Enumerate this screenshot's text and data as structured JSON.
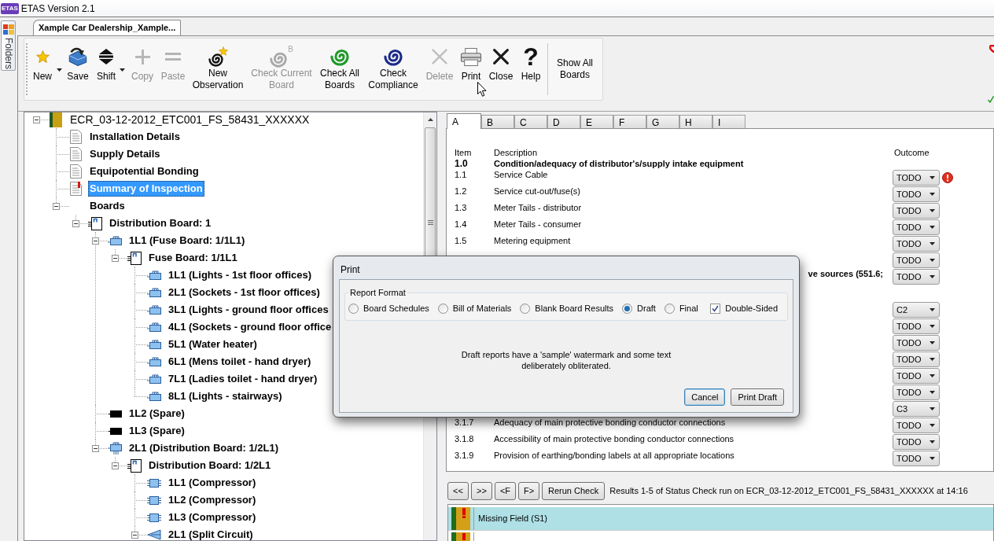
{
  "window": {
    "title": "ETAS Version 2.1",
    "logo": "ETAS"
  },
  "folders_tab": {
    "label": "Folders"
  },
  "document_tabs": [
    {
      "label": "Xample Car Dealership_Xample...",
      "selected": true
    }
  ],
  "toolbar": {
    "buttons": [
      {
        "kind": "new",
        "label": "New",
        "disabled": false,
        "dropdown": true
      },
      {
        "kind": "save",
        "label": "Save",
        "disabled": false,
        "dropdown": false
      },
      {
        "kind": "shift",
        "label": "Shift",
        "disabled": false,
        "dropdown": true
      },
      {
        "kind": "copy",
        "label": "Copy",
        "disabled": true,
        "dropdown": false
      },
      {
        "kind": "paste",
        "label": "Paste",
        "disabled": true,
        "dropdown": false
      },
      {
        "kind": "new_observation",
        "label": "New Observation",
        "disabled": false,
        "dropdown": false
      },
      {
        "kind": "check_current_board",
        "label": "Check Current Board",
        "badge": "B",
        "disabled": true,
        "dropdown": false
      },
      {
        "kind": "check_all_boards",
        "label": "Check All Boards",
        "disabled": false,
        "dropdown": false
      },
      {
        "kind": "check_compliance",
        "label": "Check Compliance",
        "disabled": false,
        "dropdown": false
      },
      {
        "kind": "delete",
        "label": "Delete",
        "disabled": true,
        "dropdown": false
      },
      {
        "kind": "print",
        "label": "Print",
        "disabled": false,
        "dropdown": false
      },
      {
        "kind": "close",
        "label": "Close",
        "disabled": false,
        "dropdown": false
      },
      {
        "kind": "help",
        "label": "Help",
        "glyph": "?",
        "disabled": false,
        "dropdown": false
      },
      {
        "kind": "show_all_boards",
        "label": "Show All Boards",
        "disabled": false,
        "dropdown": false
      }
    ]
  },
  "tree": [
    {
      "label": "ECR_03-12-2012_ETC001_FS_58431_XXXXXX",
      "kind": "report",
      "selected": false,
      "expanded": true,
      "children": [
        {
          "label": "Installation Details",
          "kind": "page",
          "selected": false
        },
        {
          "label": "Supply Details",
          "kind": "page",
          "selected": false
        },
        {
          "label": "Equipotential Bonding",
          "kind": "page",
          "selected": false
        },
        {
          "label": "Summary of Inspection",
          "kind": "page_flagged",
          "selected": true
        },
        {
          "label": "Boards",
          "kind": "group",
          "selected": false,
          "expanded": true,
          "children": [
            {
              "label": "Distribution Board: 1",
              "kind": "board",
              "selected": false,
              "expanded": true,
              "children": [
                {
                  "label": "1L1 (Fuse Board: 1/1L1)",
                  "kind": "circuit",
                  "selected": false,
                  "expanded": true,
                  "children": [
                    {
                      "label": "Fuse Board: 1/1L1",
                      "kind": "board",
                      "selected": false,
                      "expanded": true,
                      "children": [
                        {
                          "label": "1L1 (Lights - 1st floor offices)",
                          "kind": "circuit",
                          "selected": false
                        },
                        {
                          "label": "2L1 (Sockets - 1st floor offices)",
                          "kind": "circuit",
                          "selected": false
                        },
                        {
                          "label": "3L1 (Lights - ground floor offices",
                          "kind": "circuit",
                          "selected": false
                        },
                        {
                          "label": "4L1 (Sockets - ground floor office",
                          "kind": "circuit",
                          "selected": false
                        },
                        {
                          "label": "5L1 (Water heater)",
                          "kind": "circuit",
                          "selected": false
                        },
                        {
                          "label": "6L1 (Mens toilet - hand dryer)",
                          "kind": "circuit",
                          "selected": false
                        },
                        {
                          "label": "7L1 (Ladies toilet - hand dryer)",
                          "kind": "circuit",
                          "selected": false
                        },
                        {
                          "label": "8L1 (Lights - stairways)",
                          "kind": "circuit",
                          "selected": false
                        }
                      ]
                    }
                  ]
                },
                {
                  "label": "1L2 (Spare)",
                  "kind": "spare",
                  "selected": false
                },
                {
                  "label": "1L3 (Spare)",
                  "kind": "spare",
                  "selected": false
                },
                {
                  "label": "2L1 (Distribution Board: 1/2L1)",
                  "kind": "feeder",
                  "selected": false,
                  "expanded": true,
                  "children": [
                    {
                      "label": "Distribution Board: 1/2L1",
                      "kind": "board",
                      "selected": false,
                      "expanded": true,
                      "children": [
                        {
                          "label": "1L1 (Compressor)",
                          "kind": "motor",
                          "selected": false
                        },
                        {
                          "label": "1L2 (Compressor)",
                          "kind": "motor",
                          "selected": false
                        },
                        {
                          "label": "1L3 (Compressor)",
                          "kind": "motor",
                          "selected": false
                        },
                        {
                          "label": "2L1 (Split Circuit)",
                          "kind": "split",
                          "selected": false,
                          "expanded": true
                        }
                      ]
                    }
                  ]
                }
              ]
            }
          ]
        }
      ]
    }
  ],
  "sheet_tabs": [
    {
      "label": "A",
      "selected": true
    },
    {
      "label": "B",
      "selected": false
    },
    {
      "label": "C",
      "selected": false
    },
    {
      "label": "D",
      "selected": false
    },
    {
      "label": "E",
      "selected": false
    },
    {
      "label": "F",
      "selected": false
    },
    {
      "label": "G",
      "selected": false
    },
    {
      "label": "H",
      "selected": false
    },
    {
      "label": "I",
      "selected": false
    }
  ],
  "checklist": {
    "columns": [
      "Item",
      "Description",
      "Outcome"
    ],
    "rows": [
      {
        "kind": "heading",
        "item": "1.0",
        "description": "Condition/adequacy of distributor's/supply intake equipment"
      },
      {
        "kind": "item",
        "item": "1.1",
        "description": "Service Cable",
        "outcome": "TODO",
        "flagged": true
      },
      {
        "kind": "item",
        "item": "1.2",
        "description": "Service cut-out/fuse(s)",
        "outcome": "TODO",
        "flagged": false
      },
      {
        "kind": "item",
        "item": "1.3",
        "description": "Meter Tails - distributor",
        "outcome": "TODO",
        "flagged": false
      },
      {
        "kind": "item",
        "item": "1.4",
        "description": "Meter Tails - consumer",
        "outcome": "TODO",
        "flagged": false
      },
      {
        "kind": "item",
        "item": "1.5",
        "description": "Metering equipment",
        "outcome": "TODO",
        "flagged": false
      },
      {
        "kind": "item",
        "outcome": "TODO",
        "flagged": false
      },
      {
        "kind": "wrapped",
        "description": "ve sources (551.6;",
        "outcome": "TODO",
        "flagged": false
      },
      {
        "kind": "item",
        "outcome": "C2",
        "flagged": false
      },
      {
        "kind": "item",
        "outcome": "TODO",
        "flagged": false
      },
      {
        "kind": "item",
        "outcome": "TODO",
        "flagged": false
      },
      {
        "kind": "item",
        "outcome": "TODO",
        "flagged": false
      },
      {
        "kind": "item",
        "outcome": "TODO",
        "flagged": false
      },
      {
        "kind": "item",
        "outcome": "TODO",
        "flagged": false
      },
      {
        "kind": "item",
        "outcome": "C3",
        "flagged": false
      },
      {
        "kind": "item",
        "item": "3.1.7",
        "description": "Adequacy of main protective bonding conductor connections",
        "outcome": "TODO",
        "flagged": false
      },
      {
        "kind": "item",
        "item": "3.1.8",
        "description": "Accessibility of main protective bonding conductor connections",
        "outcome": "TODO",
        "flagged": false
      },
      {
        "kind": "item",
        "item": "3.1.9",
        "description": "Provision of earthing/bonding labels at all appropriate locations",
        "outcome": "TODO",
        "flagged": false
      }
    ]
  },
  "results_bar": {
    "buttons": [
      {
        "kind": "first",
        "label": "<<"
      },
      {
        "kind": "last",
        "label": ">>"
      },
      {
        "kind": "prev_flag",
        "label": "<F"
      },
      {
        "kind": "next_flag",
        "label": "F>"
      },
      {
        "kind": "rerun",
        "label": "Rerun Check"
      }
    ],
    "summary": "Results 1-5 of Status Check run on ECR_03-12-2012_ETC001_FS_58431_XXXXXX at 14:16"
  },
  "results": [
    {
      "label": "Missing Field (S1)",
      "selected": true
    },
    {
      "selected": false
    }
  ],
  "print_dialog": {
    "title": "Print",
    "group_label": "Report Format",
    "formats": [
      {
        "label": "Board Schedules",
        "selected": false
      },
      {
        "label": "Bill of Materials",
        "selected": false
      },
      {
        "label": "Blank Board Results",
        "selected": false
      },
      {
        "label": "Draft",
        "selected": true
      },
      {
        "label": "Final",
        "selected": false
      }
    ],
    "double_sided": {
      "label": "Double-Sided",
      "checked": true
    },
    "message": "Draft reports have a 'sample' watermark and some text deliberately obliterated.",
    "buttons": [
      {
        "label": "Cancel",
        "focused": true
      },
      {
        "label": "Print Draft",
        "focused": false
      }
    ]
  }
}
